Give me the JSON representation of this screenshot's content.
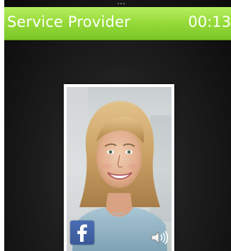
{
  "status_bar": {
    "title": "Service Provider",
    "call_timer": "00:13"
  },
  "contact_card": {
    "photo": "contact-portrait-smiling-woman",
    "social_badge_icon": "facebook-icon",
    "audio_icon": "speaker-icon"
  },
  "colors": {
    "header_green": "#98dc3c",
    "background": "#141414",
    "facebook_blue": "#3b5998"
  }
}
